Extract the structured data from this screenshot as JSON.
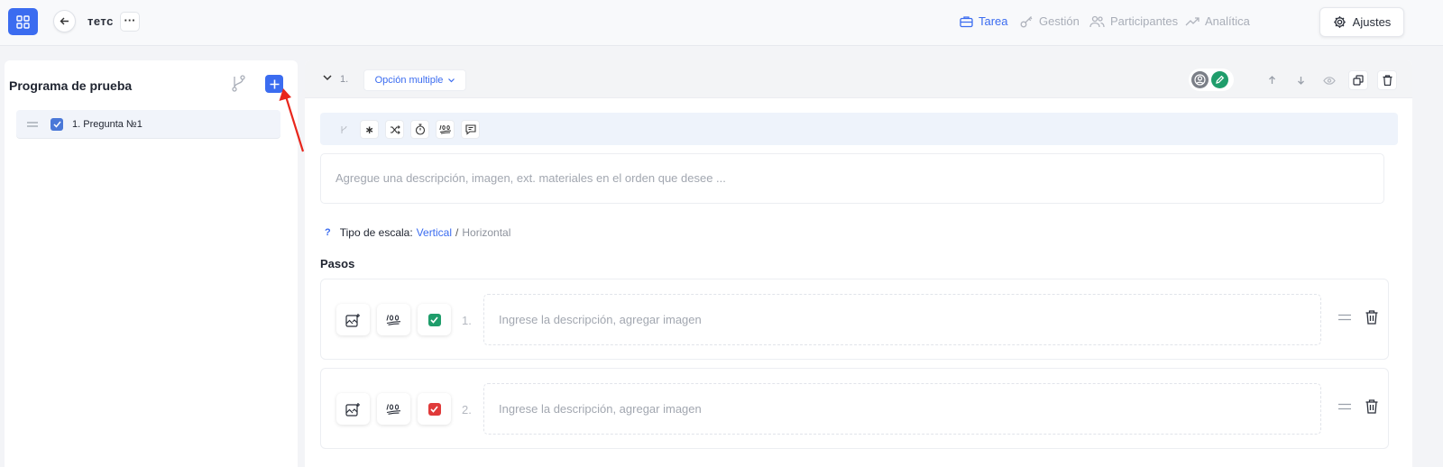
{
  "header": {
    "title": "тетс",
    "more": "···",
    "nav": [
      {
        "label": "Tarea",
        "icon": "briefcase-icon",
        "active": true
      },
      {
        "label": "Gestión",
        "icon": "key-icon",
        "active": false
      },
      {
        "label": "Participantes",
        "icon": "users-icon",
        "active": false
      },
      {
        "label": "Analítica",
        "icon": "trending-up-icon",
        "active": false
      }
    ],
    "settings_label": "Ajustes"
  },
  "sidebar": {
    "title": "Programa de prueba",
    "items": [
      {
        "label": "1. Pregunta №1",
        "checked": true
      }
    ]
  },
  "question": {
    "number": "1.",
    "type": "Opción multiple",
    "description_placeholder": "Agregue una descripción, imagen, ext. materiales en el orden que desee ...",
    "scale": {
      "help": "?",
      "label": "Tipo de escala:",
      "vertical": "Vertical",
      "separator": "/",
      "horizontal": "Horizontal"
    },
    "steps_title": "Pasos",
    "steps": [
      {
        "number": "1.",
        "placeholder": "Ingrese la descripción, agregar imagen",
        "correct": true
      },
      {
        "number": "2.",
        "placeholder": "Ingrese la descripción, agregar imagen",
        "correct": false
      }
    ]
  },
  "colors": {
    "accent": "#3b6cf0",
    "correct": "#1f9d6b",
    "wrong": "#e03a3a",
    "annotation_arrow": "#e8261c"
  }
}
